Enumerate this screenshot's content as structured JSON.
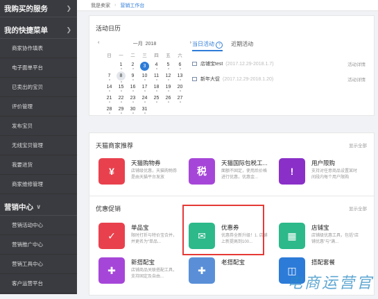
{
  "sidebar": {
    "section1": "我购买的服务",
    "section2": "我的快捷菜单",
    "quick_items": [
      "商家协作填表",
      "电子面单平台",
      "已卖出的宝贝",
      "评价管理",
      "发布宝贝",
      "无线宝贝管理",
      "我要进货",
      "商家维修管理"
    ],
    "section3": "营销中心",
    "marketing_items": [
      "营销活动中心",
      "营销推广中心",
      "营销工具中心",
      "客户运营平台"
    ]
  },
  "breadcrumb": {
    "root": "我是卖家",
    "current": "营销工作台"
  },
  "calendar_panel": {
    "title": "活动日历",
    "month": "一月",
    "year": "2018",
    "weekdays": [
      "日",
      "一",
      "二",
      "三",
      "四",
      "五",
      "六"
    ],
    "weeks": [
      [
        "",
        "1",
        "2",
        "3",
        "4",
        "5",
        "6"
      ],
      [
        "7",
        "8",
        "9",
        "10",
        "11",
        "12",
        "13"
      ],
      [
        "14",
        "15",
        "16",
        "17",
        "18",
        "19",
        "20"
      ],
      [
        "21",
        "22",
        "23",
        "24",
        "25",
        "26",
        "27"
      ],
      [
        "28",
        "29",
        "30",
        "31",
        "",
        "",
        ""
      ]
    ],
    "tabs": [
      "当日活动",
      "近期活动"
    ],
    "activities": [
      {
        "name": "店铺宝test",
        "date": "2017.12.29-2018.1.7",
        "action": "活动详情"
      },
      {
        "name": "新年大促",
        "date": "2017.12.29-2018.1.20",
        "action": "活动详情"
      }
    ]
  },
  "tmall_panel": {
    "title": "天猫商家推荐",
    "show_all": "显示全部",
    "cards": [
      {
        "name": "天猫购物券",
        "desc": "店铺级优惠，天猫购物券是由天猫平台发放",
        "icon": "ticket-icon",
        "color": "#e8414d"
      },
      {
        "name": "天猫国际包税工...",
        "desc": "面额不固定，使用后价格进行优惠，优惠金...",
        "icon": "tax-icon",
        "color": "#a646d8"
      },
      {
        "name": "用户限购",
        "desc": "支持对任意商品设置某时间段内每个用户限购",
        "icon": "limit-icon",
        "color": "#8a30c8"
      }
    ]
  },
  "promo_panel": {
    "title": "优惠促销",
    "show_all": "显示全部",
    "cards": [
      {
        "name": "单品宝",
        "desc": "限时打折与特价宝合并，并更名为“单品...",
        "icon": "tag-icon",
        "color": "#e8414d"
      },
      {
        "name": "优惠券",
        "desc": "优惠券全新升级！1. 店铺上新提高到100...",
        "icon": "coupon-icon",
        "color": "#2db98a"
      },
      {
        "name": "店铺宝",
        "desc": "店铺级优惠工具，包括“店铺优惠”与“满...",
        "icon": "shop-icon",
        "color": "#2db98a"
      },
      {
        "name": "新搭配宝",
        "desc": "店铺商品关联搭配工具，支持固定及自由...",
        "icon": "puzzle-icon",
        "color": "#a646d8"
      },
      {
        "name": "老搭配宝",
        "desc": "",
        "icon": "puzzle2-icon",
        "color": "#5a8fd8"
      },
      {
        "name": "搭配套餐",
        "desc": "",
        "icon": "bundle-icon",
        "color": "#2d7bd8"
      }
    ]
  },
  "watermark": "电商运营官"
}
